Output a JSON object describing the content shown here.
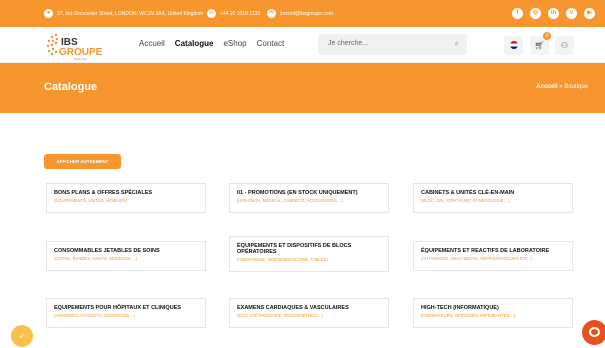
{
  "topbar": {
    "address": "27, old Gloucester Street, LONDON, WC1N 3AX, United Kingdom",
    "phone": "+44 20 3318 1133",
    "email": "ibrconf@ibsgroupe.com",
    "social_icons": [
      "facebook-icon",
      "instagram-icon",
      "linkedin-icon",
      "vimeo-icon",
      "youtube-icon"
    ]
  },
  "header": {
    "logo_top": "IBS",
    "logo_bottom": "GROUPE",
    "logo_tagline": "bleibt Zeit",
    "nav": [
      "Accueil",
      "Catalogue",
      "eShop",
      "Contact"
    ],
    "active_nav": "Catalogue",
    "search_placeholder": "Je cherche...",
    "cart_count": "0"
  },
  "banner": {
    "title": "Catalogue",
    "breadcrumb_home": "Accueil",
    "breadcrumb_sep": " » ",
    "breadcrumb_current": "Boutique"
  },
  "afficher_label": "AFFICHER AUTREMENT",
  "cards": [
    {
      "title": "BONS PLANS & OFFRES SPÉCIALES",
      "subtitle": "(ÉQUIPEMENTS, UNITÉS, MOBILIER)"
    },
    {
      "title": "01 - PROMOTIONS (EN STOCK UNIQUEMENT)",
      "subtitle": "(HIGHTECH, MÉDICAL, CABINETS, ACCESSOIRES,...)"
    },
    {
      "title": "CABINETS & UNITÉS CLÉ-EN-MAIN",
      "subtitle": "(BLOC, ORL, OPHTALMO, GYNÉCOLOGIE,...)"
    },
    {
      "title": "CONSOMMABLES JETABLES DE SOINS",
      "subtitle": "(COTON, BANDES, GANTS, SERINGUE,...)"
    },
    {
      "title": "ÉQUIPEMENTS ET DISPOSITIFS DE BLOCS OPÉRATOIRES",
      "subtitle": "(ANESTHÉSIE, VIDÉOENDOSCOPIE, TABLES)"
    },
    {
      "title": "ÉQUIPEMENTS ET REACTIFS DE LABORATOIRE",
      "subtitle": "(AUTOMATES, ANALYSEURS, RÉFRIGÉRATEURS ETC.,)"
    },
    {
      "title": "EQUIPEMENTS POUR HÔPITAUX ET CLINIQUES",
      "subtitle": "(ARMOIRES, CHARIOTS, GUÉRIDONS,...)"
    },
    {
      "title": "EXAMENS CARDIAQUES & VASCULAIRES",
      "subtitle": "(ECG, STÉTHOSCOPE, TENSIOMÈTRES,...)"
    },
    {
      "title": "HIGH-TECH (INFORMATIQUE)",
      "subtitle": "(ORDINATEURS, SERVEURS, IMPRIMANTES,...)"
    }
  ],
  "colors": {
    "accent": "#f7952f",
    "chat": "#e8501d"
  }
}
